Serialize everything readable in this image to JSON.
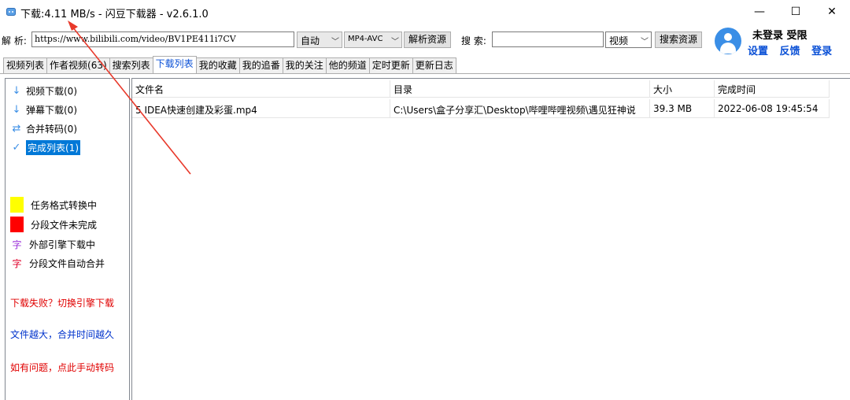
{
  "window": {
    "title": "下载:4.11 MB/s - 闪豆下载器 - v2.6.1.0",
    "controls": {
      "minimize": "—",
      "maximize": "☐",
      "close": "✕"
    }
  },
  "toolbar": {
    "parse_label": "解 析:",
    "url_value": "https://www.bilibili.com/video/BV1PE411i7CV",
    "quality_value": "自动",
    "codec_value": "MP4-AVC",
    "parse_button": "解析资源",
    "search_label": "搜 索:",
    "search_value": "",
    "search_type_value": "视频",
    "search_button": "搜索资源"
  },
  "user": {
    "status": "未登录 受限",
    "links": {
      "settings": "设置",
      "feedback": "反馈",
      "login": "登录"
    }
  },
  "tabs": [
    {
      "label": "视频列表",
      "active": false
    },
    {
      "label": "作者视频(63)",
      "active": false
    },
    {
      "label": "搜索列表",
      "active": false
    },
    {
      "label": "下载列表",
      "active": true
    },
    {
      "label": "我的收藏",
      "active": false
    },
    {
      "label": "我的追番",
      "active": false
    },
    {
      "label": "我的关注",
      "active": false
    },
    {
      "label": "他的频道",
      "active": false
    },
    {
      "label": "定时更新",
      "active": false
    },
    {
      "label": "更新日志",
      "active": false
    }
  ],
  "sidebar": {
    "items": [
      {
        "icon": "arrow-down-icon",
        "glyph": "↓",
        "label": "视频下载(0)"
      },
      {
        "icon": "arrow-down-icon",
        "glyph": "↓",
        "label": "弹幕下载(0)"
      },
      {
        "icon": "swap-arrows-icon",
        "glyph": "⇄",
        "label": "合并转码(0)"
      },
      {
        "icon": "checkmark-icon",
        "glyph": "✓",
        "label": "完成列表(1)",
        "selected": true
      }
    ],
    "legend": [
      {
        "label": "任务格式转换中",
        "color": "#ffff00"
      },
      {
        "label": "分段文件未完成",
        "color": "#ff0000"
      },
      {
        "glyph": "字",
        "glyph_color": "#9b30d9",
        "label": "外部引擎下载中"
      },
      {
        "glyph": "字",
        "glyph_color": "#e0002a",
        "label": "分段文件自动合并"
      }
    ],
    "notes": [
      {
        "text": "下载失败？切换引擎下载",
        "color": "#e00000"
      },
      {
        "text": "文件越大，合并时间越久",
        "color": "#0033cc"
      },
      {
        "text": "如有问题，点此手动转码",
        "color": "#e00000"
      }
    ]
  },
  "table": {
    "columns": [
      "文件名",
      "目录",
      "大小",
      "完成时间"
    ],
    "rows": [
      {
        "filename": "5 IDEA快速创建及彩蛋.mp4",
        "directory": "C:\\Users\\盒子分享汇\\Desktop\\哔哩哔哩视频\\遇见狂神说",
        "size": "39.3 MB",
        "completed": "2022-06-08 19:45:54"
      }
    ]
  },
  "colors": {
    "accent": "#0078d7",
    "link_blue": "#0a50d6",
    "avatar_blue": "#3a8ee6",
    "annotation_red": "#e8392b"
  }
}
